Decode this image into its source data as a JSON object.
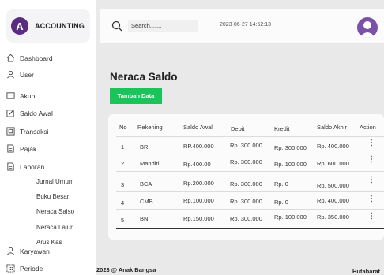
{
  "brand": {
    "logo_letter": "A",
    "name": "ACCOUNTING"
  },
  "sidebar": {
    "items": [
      {
        "label": "Dashboard",
        "icon": "home-icon"
      },
      {
        "label": "User",
        "icon": "user-icon"
      },
      {
        "label": "Akun",
        "icon": "card-icon"
      },
      {
        "label": "Saldo Awal",
        "icon": "edit-icon"
      },
      {
        "label": "Transaksi",
        "icon": "transaction-icon"
      },
      {
        "label": "Pajak",
        "icon": "document-icon"
      },
      {
        "label": "Laporan",
        "icon": "document-icon"
      }
    ],
    "laporan_sub": [
      "Jurnal Umum",
      "Buku Besar",
      "Neraca Salso",
      "Neraca Lajur",
      "Arus Kas"
    ],
    "bottom_items": [
      {
        "label": "Karyawan",
        "icon": "user-icon"
      },
      {
        "label": "Periode",
        "icon": "calendar-icon"
      }
    ]
  },
  "topbar": {
    "search_placeholder": "Search.......",
    "datetime": "2023-06-27 14:52:13"
  },
  "page": {
    "title": "Neraca Saldo",
    "add_button": "Tambah Data"
  },
  "table": {
    "headers": [
      "No",
      "Rekening",
      "Saldo Awal",
      "Debit",
      "Kredit",
      "Saldo Akhir",
      "Action"
    ],
    "rows": [
      [
        "1",
        "BRI",
        "RP.400.000",
        "Rp. 300.000",
        "Rp. 300.000",
        "Rp. 400.000"
      ],
      [
        "2",
        "Mandiri",
        "Rp.400.00",
        "Rp. 300.000",
        "Rp. 100.000",
        "Rp. 600.000"
      ],
      [
        "3",
        "BCA",
        "Rp.200.000",
        "Rp. 300.000",
        "Rp.  0",
        "Rp. 500.000"
      ],
      [
        "4",
        "CMB",
        "Rp.100.000",
        "Rp. 300.000",
        "Rp.  0",
        "Rp. 400.000"
      ],
      [
        "5",
        "BNI",
        "Rp.150.000",
        "Rp. 300.000",
        "Rp. 100.000",
        "Rp. 350.000"
      ]
    ],
    "action_icon": "⋮"
  },
  "footer": {
    "left": "2023 @ Anak Bangsa",
    "right": "Hutabarat"
  },
  "colors": {
    "accent_green": "#1cc25a",
    "brand_purple": "#5a2d82",
    "avatar_purple": "#7b52a8"
  }
}
